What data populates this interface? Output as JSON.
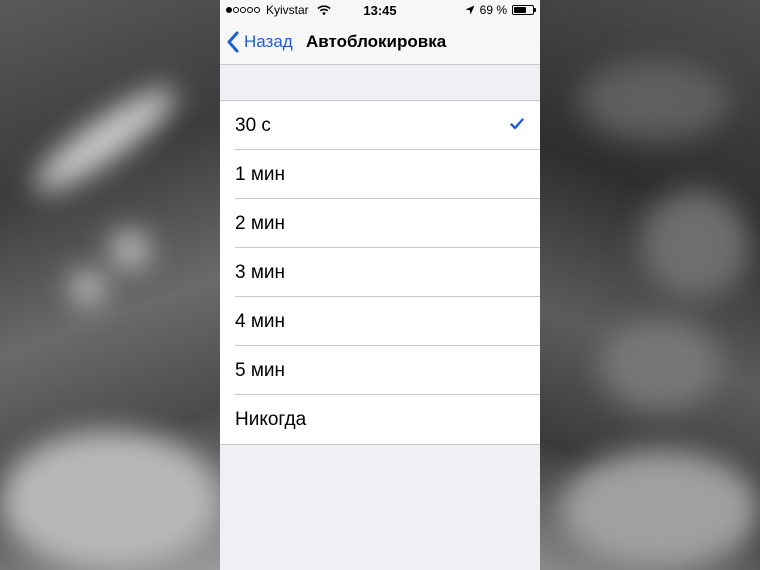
{
  "status_bar": {
    "signal_dots_filled": 1,
    "signal_dots_total": 5,
    "carrier": "Kyivstar",
    "time": "13:45",
    "battery_text": "69 %",
    "battery_level": 0.69,
    "icons": [
      "wifi-icon",
      "location-arrow-icon",
      "battery-icon"
    ]
  },
  "nav": {
    "back_label": "Назад",
    "title": "Автоблокировка"
  },
  "options": [
    {
      "label": "30 с",
      "selected": true
    },
    {
      "label": "1 мин",
      "selected": false
    },
    {
      "label": "2 мин",
      "selected": false
    },
    {
      "label": "3 мин",
      "selected": false
    },
    {
      "label": "4 мин",
      "selected": false
    },
    {
      "label": "5 мин",
      "selected": false
    },
    {
      "label": "Никогда",
      "selected": false
    }
  ],
  "colors": {
    "accent": "#1f5fd6",
    "background": "#efeff4",
    "separator": "#c8c7cc"
  }
}
